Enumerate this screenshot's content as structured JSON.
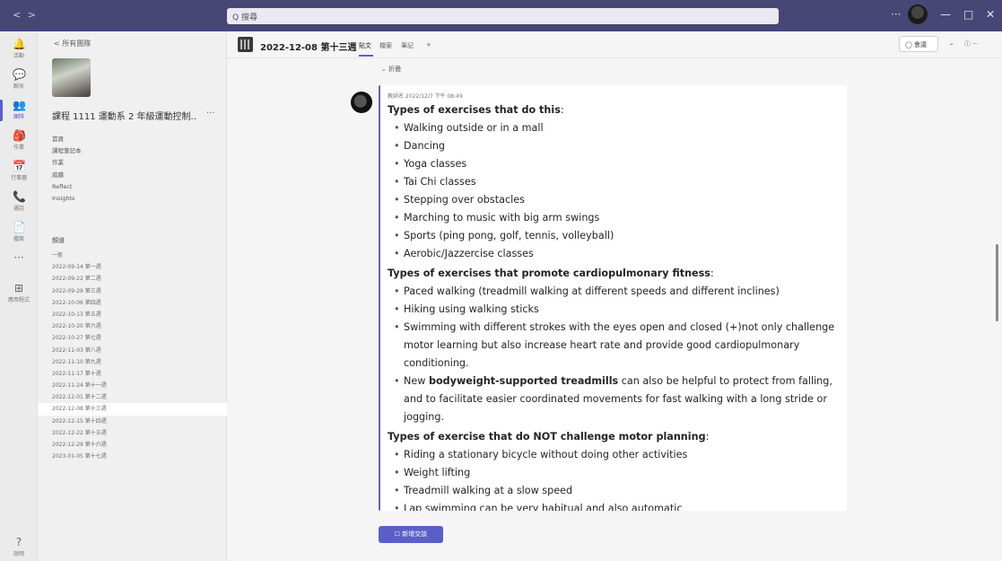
{
  "titlebar": {
    "nav": "< >",
    "search_text": "Q 搜尋",
    "more": "···",
    "minimize": "—",
    "maximize": "□",
    "close": "✕"
  },
  "rail": [
    {
      "icon": "bell-icon",
      "glyph": "🔔",
      "label": "活動",
      "active": false
    },
    {
      "icon": "chat-icon",
      "glyph": "💬",
      "label": "聊天",
      "active": false
    },
    {
      "icon": "teams-icon",
      "glyph": "👥",
      "label": "團隊",
      "active": true
    },
    {
      "icon": "assignments-icon",
      "glyph": "🎒",
      "label": "作業",
      "active": false
    },
    {
      "icon": "calendar-icon",
      "glyph": "📅",
      "label": "行事曆",
      "active": false
    },
    {
      "icon": "calls-icon",
      "glyph": "📞",
      "label": "通話",
      "active": false
    },
    {
      "icon": "files-icon",
      "glyph": "📄",
      "label": "檔案",
      "active": false
    },
    {
      "icon": "more-icon",
      "glyph": "···",
      "label": "",
      "active": false
    },
    {
      "icon": "apps-icon",
      "glyph": "⊞",
      "label": "應用程式",
      "active": false
    },
    {
      "icon": "help-icon",
      "glyph": "?",
      "label": "說明",
      "active": false
    }
  ],
  "panel": {
    "back": "< 所有團隊",
    "team_name": "課程 1111 運動系 2 年級運動控制...",
    "team_more": "···",
    "pinned": [
      "首頁",
      "課程筆記本",
      "作業",
      "成績",
      "Reflect",
      "Insights"
    ],
    "channels_label": "頻道",
    "channels": [
      "一般",
      "2022-09-14 第一週",
      "2022-09-22 第二週",
      "2022-09-29 第三週",
      "2022-10-06 第四週",
      "2022-10-13 第五週",
      "2022-10-20 第六週",
      "2022-10-27 第七週",
      "2022-11-03 第八週",
      "2022-11-10 第九週",
      "2022-11-17 第十週",
      "2022-11-24 第十一週",
      "2022-12-01 第十二週",
      "2022-12-08 第十三週",
      "2022-12-15 第十四週",
      "2022-12-22 第十五週",
      "2022-12-29 第十六週",
      "2023-01-05 第十七週"
    ],
    "selected_channel": 13
  },
  "header": {
    "title": "2022-12-08 第十三週",
    "tabs": [
      "貼文",
      "檔案",
      "筆記",
      "+"
    ],
    "meet": "◯ 會議",
    "chevron": "⌄",
    "info": "ⓘ ···"
  },
  "collapse": "⌄ 折疊",
  "post": {
    "meta": "教師名  2022/12/7 下午 08:49",
    "sections": [
      {
        "heading": "Types of exercises that do this",
        "items": [
          {
            "text": "Walking outside or in a mall"
          },
          {
            "text": "Dancing"
          },
          {
            "text": "Yoga classes"
          },
          {
            "text": "Tai Chi classes"
          },
          {
            "text": "Stepping over obstacles"
          },
          {
            "text": "Marching to music with big arm swings"
          },
          {
            "text": "Sports (ping pong, golf, tennis, volleyball)"
          },
          {
            "text": "Aerobic/Jazzercise classes"
          }
        ]
      },
      {
        "heading": "Types of exercises that promote cardiopulmonary fitness",
        "items": [
          {
            "text": "Paced walking (treadmill walking at different speeds and different inclines)"
          },
          {
            "text": "Hiking using walking sticks"
          },
          {
            "text": "Swimming with different strokes with the eyes open and closed (+)not only challenge motor learning but also increase heart rate and provide good cardiopulmonary conditioning."
          },
          {
            "pre": "New ",
            "bold": "bodyweight-supported treadmills",
            "post": " can also be helpful to protect from falling, and to facilitate easier coordinated movements for fast walking with a long stride or jogging."
          }
        ]
      },
      {
        "heading": "Types of exercise that do NOT challenge motor planning",
        "items": [
          {
            "text": "Riding a stationary bicycle without doing other activities"
          },
          {
            "text": "Weight lifting"
          },
          {
            "text": "Treadmill walking at a slow speed"
          },
          {
            "text": "Lap swimming can be very habitual and also automatic"
          }
        ]
      }
    ]
  },
  "new_conversation": "☐ 新增交談"
}
